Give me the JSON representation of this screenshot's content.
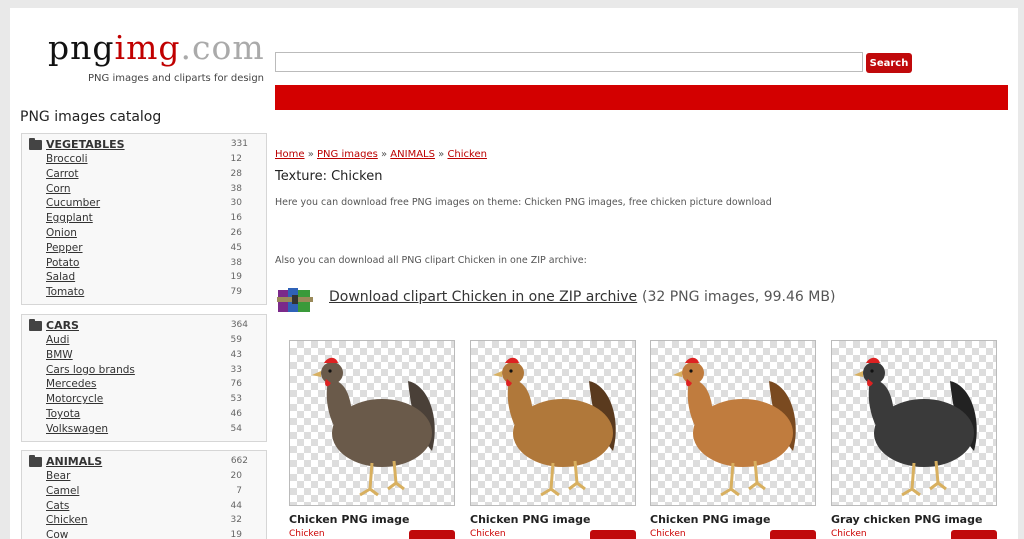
{
  "header": {
    "logo": {
      "part1": "png",
      "part2": "img",
      "part3": ".com"
    },
    "tagline": "PNG images and cliparts for design",
    "search": {
      "value": "",
      "placeholder": "",
      "button_label": "Search"
    }
  },
  "sidebar": {
    "title": "PNG images catalog",
    "categories": [
      {
        "name": "VEGETABLES",
        "count": "331",
        "items": [
          {
            "label": "Broccoli",
            "count": "12"
          },
          {
            "label": "Carrot",
            "count": "28"
          },
          {
            "label": "Corn",
            "count": "38"
          },
          {
            "label": "Cucumber",
            "count": "30"
          },
          {
            "label": "Eggplant",
            "count": "16"
          },
          {
            "label": "Onion",
            "count": "26"
          },
          {
            "label": "Pepper",
            "count": "45"
          },
          {
            "label": "Potato",
            "count": "38"
          },
          {
            "label": "Salad",
            "count": "19"
          },
          {
            "label": "Tomato",
            "count": "79"
          }
        ]
      },
      {
        "name": "CARS",
        "count": "364",
        "items": [
          {
            "label": "Audi",
            "count": "59"
          },
          {
            "label": "BMW",
            "count": "43"
          },
          {
            "label": "Cars logo brands",
            "count": "33"
          },
          {
            "label": "Mercedes",
            "count": "76"
          },
          {
            "label": "Motorcycle",
            "count": "53"
          },
          {
            "label": "Toyota",
            "count": "46"
          },
          {
            "label": "Volkswagen",
            "count": "54"
          }
        ]
      },
      {
        "name": "ANIMALS",
        "count": "662",
        "items": [
          {
            "label": "Bear",
            "count": "20"
          },
          {
            "label": "Camel",
            "count": "7"
          },
          {
            "label": "Cats",
            "count": "44"
          },
          {
            "label": "Chicken",
            "count": "32"
          },
          {
            "label": "Cow",
            "count": "19"
          }
        ]
      }
    ]
  },
  "main": {
    "breadcrumb": [
      "Home",
      "PNG images",
      "ANIMALS",
      "Chicken"
    ],
    "breadcrumb_sep": " » ",
    "title": "Texture: Chicken",
    "description": "Here you can download free PNG images on theme: Chicken PNG images, free chicken picture download",
    "zip_note": "Also you can download all PNG clipart Chicken in one ZIP archive:",
    "zip_link": "Download clipart Chicken in one ZIP archive",
    "zip_meta": "(32 PNG images, 99.46 MB)",
    "cards": [
      {
        "title": "Chicken PNG image",
        "tag": "Chicken",
        "body_color": "#6a5a4a",
        "tail_color": "#4a4038"
      },
      {
        "title": "Chicken PNG image",
        "tag": "Chicken",
        "body_color": "#b0783a",
        "tail_color": "#5a3a1e"
      },
      {
        "title": "Chicken PNG image",
        "tag": "Chicken",
        "body_color": "#c07c3e",
        "tail_color": "#7a4a20"
      },
      {
        "title": "Gray chicken PNG image",
        "tag": "Chicken",
        "body_color": "#3a3a3a",
        "tail_color": "#222222"
      }
    ]
  },
  "colors": {
    "accent": "#c0090b",
    "banner": "#d30000",
    "link": "#b00000"
  }
}
